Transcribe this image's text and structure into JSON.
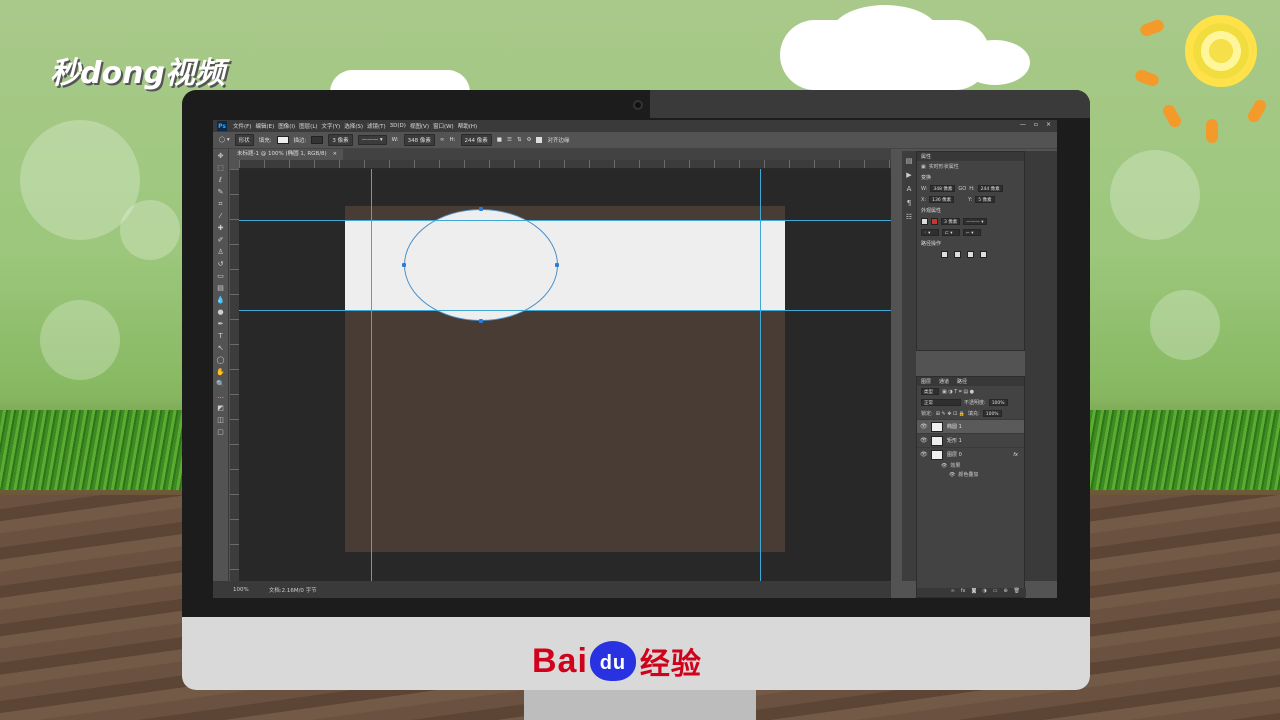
{
  "watermark": {
    "text": "秒dong视频"
  },
  "brand": {
    "bai": "Bai",
    "du": "du",
    "jingyan": "经验"
  },
  "app": {
    "logo": "Ps",
    "menu": [
      "文件(F)",
      "编辑(E)",
      "图像(I)",
      "图层(L)",
      "文字(Y)",
      "选择(S)",
      "滤镜(T)",
      "3D(D)",
      "视图(V)",
      "窗口(W)",
      "帮助(H)"
    ],
    "window_controls": [
      "—",
      "▫",
      "×"
    ]
  },
  "options_bar": {
    "shape_mode": "形状",
    "fill_label": "填充:",
    "stroke_label": "描边:",
    "stroke_width": "3 像素",
    "w_label": "W:",
    "w_value": "348 像素",
    "h_label": "H:",
    "h_value": "244 像素",
    "align_edges": "对齐边缘"
  },
  "document": {
    "tab_title": "未标题-1 @ 100% (椭圆 1, RGB/8)",
    "tab_close": "×"
  },
  "status": {
    "zoom": "100%",
    "doc_info": "文档:2.16M/0 字节"
  },
  "properties_panel": {
    "title": "属性",
    "subtitle": "实时形状属性",
    "group_transform": "变换",
    "w_label": "W:",
    "w_value": "348 像素",
    "link_symbol": "GO",
    "h_label": "H:",
    "h_value": "244 像素",
    "x_label": "X:",
    "x_value": "136 像素",
    "y_label": "Y:",
    "y_value": "5 像素",
    "group_appearance": "外观属性",
    "stroke_width": "3 像素",
    "group_path_ops": "路径操作"
  },
  "layers_panel": {
    "tabs": [
      "图层",
      "通道",
      "路径"
    ],
    "filter": "类型",
    "blend_mode": "正常",
    "opacity_label": "不透明度:",
    "opacity_value": "100%",
    "lock_label": "锁定:",
    "fill_label": "填充:",
    "fill_value": "100%",
    "layers": [
      {
        "name": "椭圆 1",
        "selected": true,
        "fx": ""
      },
      {
        "name": "矩形 1",
        "selected": false,
        "fx": ""
      },
      {
        "name": "图层 0",
        "selected": false,
        "fx": "fx"
      }
    ],
    "effects_label": "效果",
    "effect_item": "颜色叠加"
  },
  "colors": {
    "canvas_bg": "#483c35",
    "guide": "#3fa8d6",
    "shape_fill": "#eeeeee"
  }
}
